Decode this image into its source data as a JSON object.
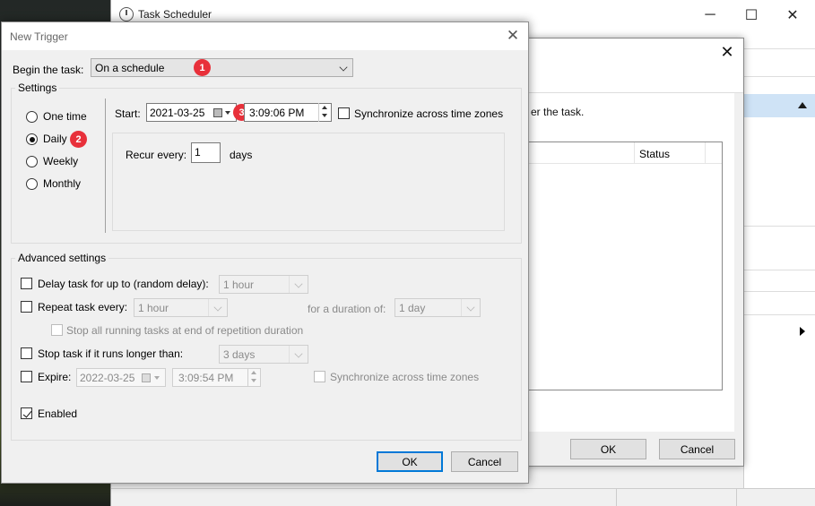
{
  "background_window": {
    "title": "Task Scheduler",
    "controls": {
      "minimize": "─",
      "maximize": "☐",
      "close": "✕"
    }
  },
  "middle_dialog": {
    "description_fragment": "er the task.",
    "list_column": "Status",
    "ok_label": "OK",
    "cancel_label": "Cancel",
    "close_glyph": "✕"
  },
  "dialog": {
    "title": "New Trigger",
    "close_glyph": "✕",
    "begin_label": "Begin the task:",
    "begin_value": "On a schedule",
    "settings_title": "Settings",
    "schedule_options": [
      {
        "label": "One time",
        "selected": false
      },
      {
        "label": "Daily",
        "selected": true
      },
      {
        "label": "Weekly",
        "selected": false
      },
      {
        "label": "Monthly",
        "selected": false
      }
    ],
    "start_label": "Start:",
    "start_date": "2021-03-25",
    "start_time": "3:09:06 PM",
    "sync_label": "Synchronize across time zones",
    "sync_checked": false,
    "recur_label": "Recur every:",
    "recur_value": "1",
    "recur_unit": "days",
    "advanced_title": "Advanced settings",
    "delay_label": "Delay task for up to (random delay):",
    "delay_value": "1 hour",
    "repeat_label": "Repeat task every:",
    "repeat_value": "1 hour",
    "duration_label": "for a duration of:",
    "duration_value": "1 day",
    "stop_all_label": "Stop all running tasks at end of repetition duration",
    "stop_longer_label": "Stop task if it runs longer than:",
    "stop_longer_value": "3 days",
    "expire_label": "Expire:",
    "expire_date": "2022-03-25",
    "expire_time": "3:09:54 PM",
    "expire_sync_label": "Synchronize across time zones",
    "enabled_label": "Enabled",
    "enabled_checked": true,
    "ok_label": "OK",
    "cancel_label": "Cancel"
  },
  "annotations": [
    "1",
    "2",
    "3"
  ],
  "colors": {
    "badge": "#e8303a",
    "primary_border": "#0078d7",
    "selection": "#cfe3f6"
  }
}
